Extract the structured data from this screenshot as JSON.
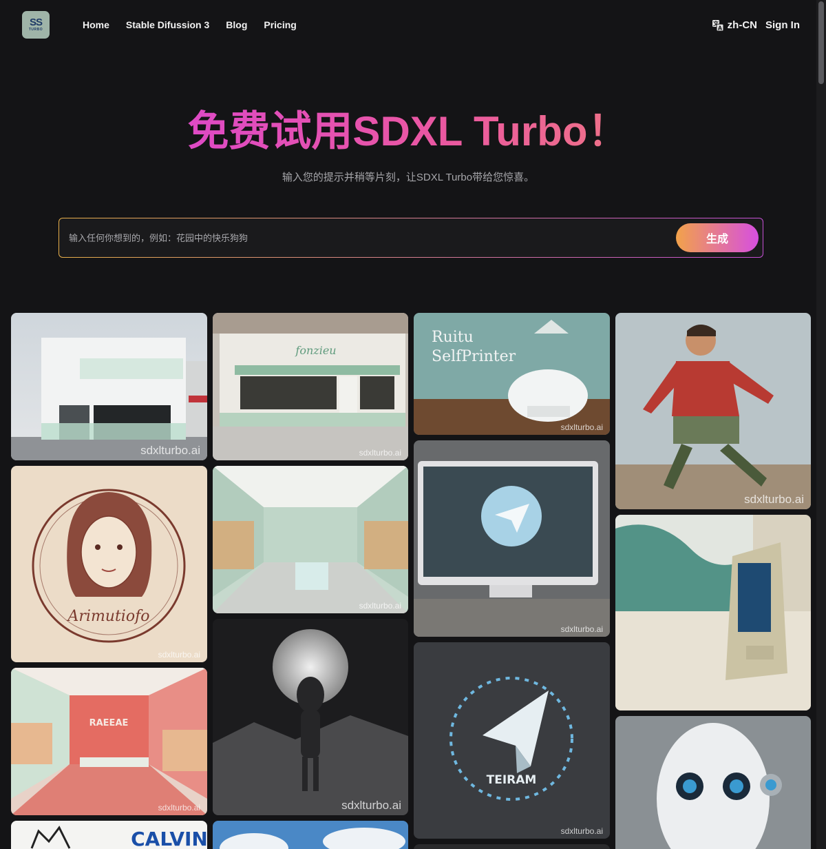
{
  "header": {
    "logo_text": "TURBO",
    "nav": [
      "Home",
      "Stable Difussion 3",
      "Blog",
      "Pricing"
    ],
    "language": "zh-CN",
    "sign_in": "Sign In"
  },
  "hero": {
    "title": "免费试用SDXL Turbo！",
    "subtitle": "输入您的提示并稍等片刻，让SDXL Turbo带给您惊喜。"
  },
  "prompt": {
    "placeholder": "输入任何你想到的，例如：花园中的快乐狗狗",
    "button": "生成"
  },
  "gallery": {
    "watermark": "sdxlturbo.ai",
    "items": [
      {
        "name": "white-mint-cafe-building",
        "text": ""
      },
      {
        "name": "mint-storefront",
        "text": "fonzieu"
      },
      {
        "name": "ruitu-printer-ad",
        "text": "Ruitu SelfPrinter"
      },
      {
        "name": "soccer-player-leaping",
        "text": ""
      },
      {
        "name": "girl-portrait-logo",
        "text": "Arimutiofo"
      },
      {
        "name": "mint-bakery-interior",
        "text": ""
      },
      {
        "name": "computer-telegram-screen",
        "text": ""
      },
      {
        "name": "self-service-kiosk",
        "text": ""
      },
      {
        "name": "pink-bakery-interior",
        "text": "RAEEAE"
      },
      {
        "name": "alien-on-moon",
        "text": ""
      },
      {
        "name": "telegram-logo",
        "text": "TEIRAM"
      },
      {
        "name": "white-robot-head",
        "text": ""
      },
      {
        "name": "calvin-cartoon",
        "text": "CALVIN"
      },
      {
        "name": "sky-clouds",
        "text": ""
      }
    ]
  },
  "colors": {
    "background": "#141416",
    "accent_start": "#d63fe0",
    "accent_end": "#f58f6c"
  }
}
